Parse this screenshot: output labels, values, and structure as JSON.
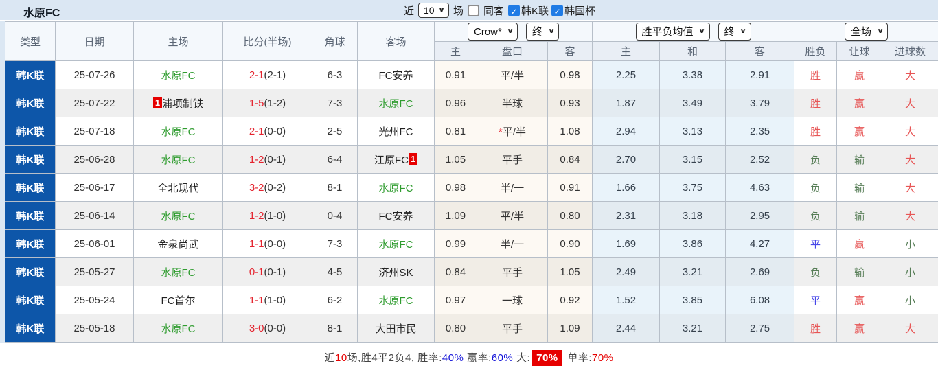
{
  "page": {
    "title": "水原FC"
  },
  "controls": {
    "recent_label": "近",
    "recent_count": "10",
    "matches_label": "场",
    "same_venue_label": "同客",
    "same_venue_checked": false,
    "league_filter_label": "韩K联",
    "league_filter_checked": true,
    "cup_filter_label": "韩国杯",
    "cup_filter_checked": true
  },
  "table": {
    "columns": {
      "type": "类型",
      "date": "日期",
      "home": "主场",
      "score": "比分(半场)",
      "corner": "角球",
      "away": "客场",
      "asia": [
        "主",
        "盘口",
        "客"
      ],
      "europe": [
        "主",
        "和",
        "客"
      ],
      "result": [
        "胜负",
        "让球",
        "进球数"
      ]
    },
    "dropdowns": {
      "bookmaker": "Crow*",
      "asia_period": "终",
      "europe_source": "胜平负均值",
      "europe_period": "终",
      "scope": "全场"
    },
    "rows": [
      {
        "league": "韩K联",
        "date": "25-07-26",
        "home": "水原FC",
        "score": "2-1",
        "half": "(2-1)",
        "corner": "6-3",
        "away": "FC安养",
        "asia_home": "0.91",
        "handicap": "平/半",
        "asia_away": "0.98",
        "eu_home": "2.25",
        "eu_draw": "3.38",
        "eu_away": "2.91",
        "result": "胜",
        "handicap_result": "赢",
        "goals": "大"
      },
      {
        "league": "韩K联",
        "date": "25-07-22",
        "home_badge_before": "1",
        "home": "浦项制铁",
        "score": "1-5",
        "half": "(1-2)",
        "corner": "7-3",
        "away": "水原FC",
        "asia_home": "0.96",
        "handicap": "半球",
        "asia_away": "0.93",
        "eu_home": "1.87",
        "eu_draw": "3.49",
        "eu_away": "3.79",
        "result": "胜",
        "handicap_result": "赢",
        "goals": "大"
      },
      {
        "league": "韩K联",
        "date": "25-07-18",
        "home": "水原FC",
        "score": "2-1",
        "half": "(0-0)",
        "corner": "2-5",
        "away": "光州FC",
        "asia_home": "0.81",
        "handicap_star": "*",
        "handicap": "平/半",
        "asia_away": "1.08",
        "eu_home": "2.94",
        "eu_draw": "3.13",
        "eu_away": "2.35",
        "result": "胜",
        "handicap_result": "赢",
        "goals": "大"
      },
      {
        "league": "韩K联",
        "date": "25-06-28",
        "home": "水原FC",
        "score": "1-2",
        "half": "(0-1)",
        "corner": "6-4",
        "away": "江原FC",
        "away_badge_after": "1",
        "asia_home": "1.05",
        "handicap": "平手",
        "asia_away": "0.84",
        "eu_home": "2.70",
        "eu_draw": "3.15",
        "eu_away": "2.52",
        "result": "负",
        "handicap_result": "输",
        "goals": "大"
      },
      {
        "league": "韩K联",
        "date": "25-06-17",
        "home": "全北现代",
        "score": "3-2",
        "half": "(0-2)",
        "corner": "8-1",
        "away": "水原FC",
        "asia_home": "0.98",
        "handicap": "半/一",
        "asia_away": "0.91",
        "eu_home": "1.66",
        "eu_draw": "3.75",
        "eu_away": "4.63",
        "result": "负",
        "handicap_result": "输",
        "goals": "大"
      },
      {
        "league": "韩K联",
        "date": "25-06-14",
        "home": "水原FC",
        "score": "1-2",
        "half": "(1-0)",
        "corner": "0-4",
        "away": "FC安养",
        "asia_home": "1.09",
        "handicap": "平/半",
        "asia_away": "0.80",
        "eu_home": "2.31",
        "eu_draw": "3.18",
        "eu_away": "2.95",
        "result": "负",
        "handicap_result": "输",
        "goals": "大"
      },
      {
        "league": "韩K联",
        "date": "25-06-01",
        "home": "金泉尚武",
        "score": "1-1",
        "half": "(0-0)",
        "corner": "7-3",
        "away": "水原FC",
        "asia_home": "0.99",
        "handicap": "半/一",
        "asia_away": "0.90",
        "eu_home": "1.69",
        "eu_draw": "3.86",
        "eu_away": "4.27",
        "result": "平",
        "handicap_result": "赢",
        "goals": "小"
      },
      {
        "league": "韩K联",
        "date": "25-05-27",
        "home": "水原FC",
        "score": "0-1",
        "half": "(0-1)",
        "corner": "4-5",
        "away": "济州SK",
        "asia_home": "0.84",
        "handicap": "平手",
        "asia_away": "1.05",
        "eu_home": "2.49",
        "eu_draw": "3.21",
        "eu_away": "2.69",
        "result": "负",
        "handicap_result": "输",
        "goals": "小"
      },
      {
        "league": "韩K联",
        "date": "25-05-24",
        "home": "FC首尔",
        "score": "1-1",
        "half": "(1-0)",
        "corner": "6-2",
        "away": "水原FC",
        "asia_home": "0.97",
        "handicap": "一球",
        "asia_away": "0.92",
        "eu_home": "1.52",
        "eu_draw": "3.85",
        "eu_away": "6.08",
        "result": "平",
        "handicap_result": "赢",
        "goals": "小"
      },
      {
        "league": "韩K联",
        "date": "25-05-18",
        "home": "水原FC",
        "score": "3-0",
        "half": "(0-0)",
        "corner": "8-1",
        "away": "大田市民",
        "asia_home": "0.80",
        "handicap": "平手",
        "asia_away": "1.09",
        "eu_home": "2.44",
        "eu_draw": "3.21",
        "eu_away": "2.75",
        "result": "胜",
        "handicap_result": "赢",
        "goals": "大"
      }
    ]
  },
  "summary": {
    "recent_label": "近",
    "recent_count": "10",
    "record_text": "场,胜4平2负4, 胜率:",
    "win_rate": "40%",
    "handicap_label": " 赢率:",
    "handicap_rate": "60%",
    "big_label": " 大:",
    "big_rate": "70%",
    "single_label": " 单率:",
    "single_rate": "70%"
  },
  "colors": {
    "league_cell": "#0d56a9",
    "self_team_green": "#2f9c2f",
    "score_red": "#e4232e",
    "win_red": "#e75555",
    "draw_blue": "#4747e8",
    "lose_green": "#567d56",
    "checkbox_blue": "#1f7be5",
    "summary_highlight_bg": "#e60000",
    "topbar_bg": "#dbe7f3"
  }
}
